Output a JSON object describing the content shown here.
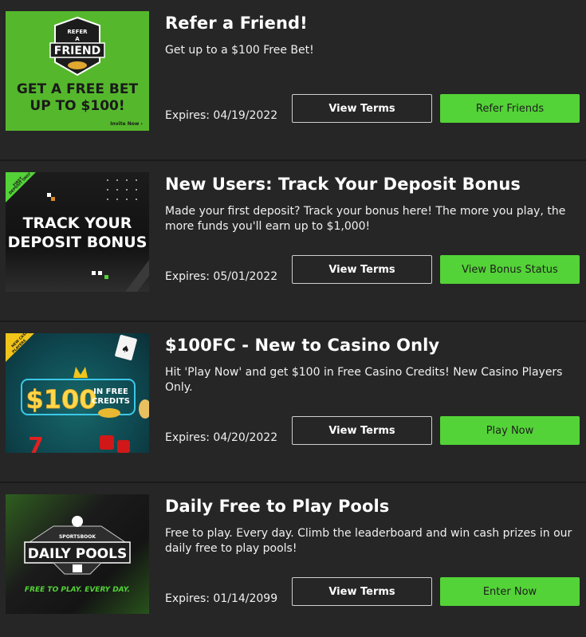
{
  "promos": [
    {
      "title": "Refer a Friend!",
      "description": "Get up to a $100 Free Bet!",
      "expires": "Expires: 04/19/2022",
      "terms_label": "View Terms",
      "action_label": "Refer Friends",
      "image": {
        "badge_top": "REFER",
        "badge_mid": "A",
        "badge_main": "FRIEND",
        "headline_1": "GET A FREE BET",
        "headline_2": "UP TO $100!",
        "cta": "Invite Now ›"
      }
    },
    {
      "title": "New Users: Track Your Deposit Bonus",
      "description": "Made your first deposit? Track your bonus here! The more you play, the more funds you'll earn up to $1,000!",
      "expires": "Expires: 05/01/2022",
      "terms_label": "View Terms",
      "action_label": "View Bonus Status",
      "image": {
        "ribbon_1": "FIRST",
        "ribbon_2": "DEPOSIT ONLY",
        "headline_1": "TRACK YOUR",
        "headline_2": "DEPOSIT BONUS"
      }
    },
    {
      "title": "$100FC - New to Casino Only",
      "description": "Hit 'Play Now' and get $100 in Free Casino Credits! New Casino Players Only.",
      "expires": "Expires: 04/20/2022",
      "terms_label": "View Terms",
      "action_label": "Play Now",
      "image": {
        "ribbon_1": "NEW CASINO",
        "ribbon_2": "PLAYERS",
        "amount": "$100",
        "line_1": "IN FREE",
        "line_2": "CREDITS"
      }
    },
    {
      "title": "Daily Free to Play Pools",
      "description": "Free to play. Every day. Climb the leaderboard and win cash prizes in our daily free to play pools!",
      "expires": "Expires: 01/14/2099",
      "terms_label": "View Terms",
      "action_label": "Enter Now",
      "image": {
        "brand": "SPORTSBOOK",
        "headline": "DAILY POOLS",
        "tagline": "FREE TO PLAY. EVERY DAY."
      }
    }
  ],
  "colors": {
    "background": "#262626",
    "accent_green": "#53d337",
    "divider": "#1a1a1a"
  }
}
